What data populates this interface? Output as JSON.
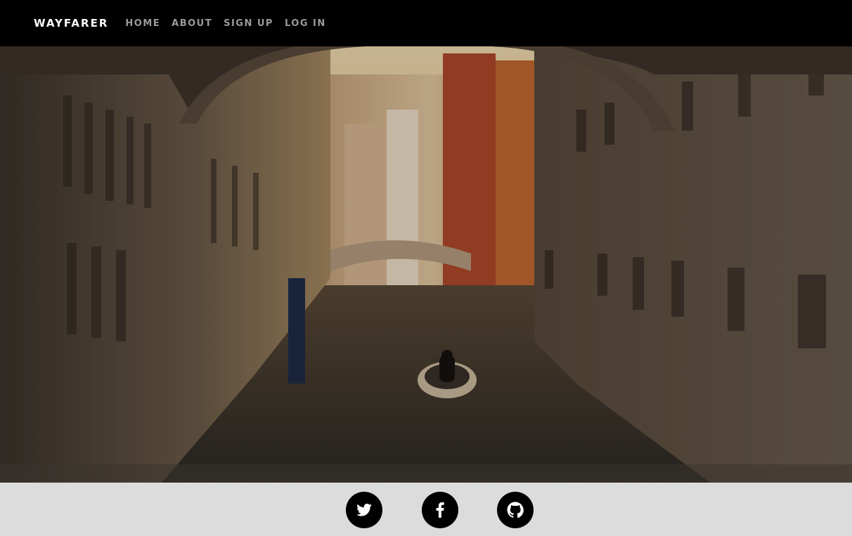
{
  "navbar": {
    "brand": "WAYFARER",
    "links": [
      {
        "label": "HOME"
      },
      {
        "label": "ABOUT"
      },
      {
        "label": "SIGN UP"
      },
      {
        "label": "LOG IN"
      }
    ]
  },
  "hero": {
    "image_icon": "venice-canal-photo"
  },
  "footer": {
    "social": [
      {
        "icon": "twitter-icon"
      },
      {
        "icon": "facebook-icon"
      },
      {
        "icon": "github-icon"
      }
    ]
  },
  "colors": {
    "navbar_bg": "#000000",
    "nav_link": "#9a9a9a",
    "brand": "#ffffff",
    "footer_bg": "#dcdcdc",
    "social_bg": "#000000"
  }
}
